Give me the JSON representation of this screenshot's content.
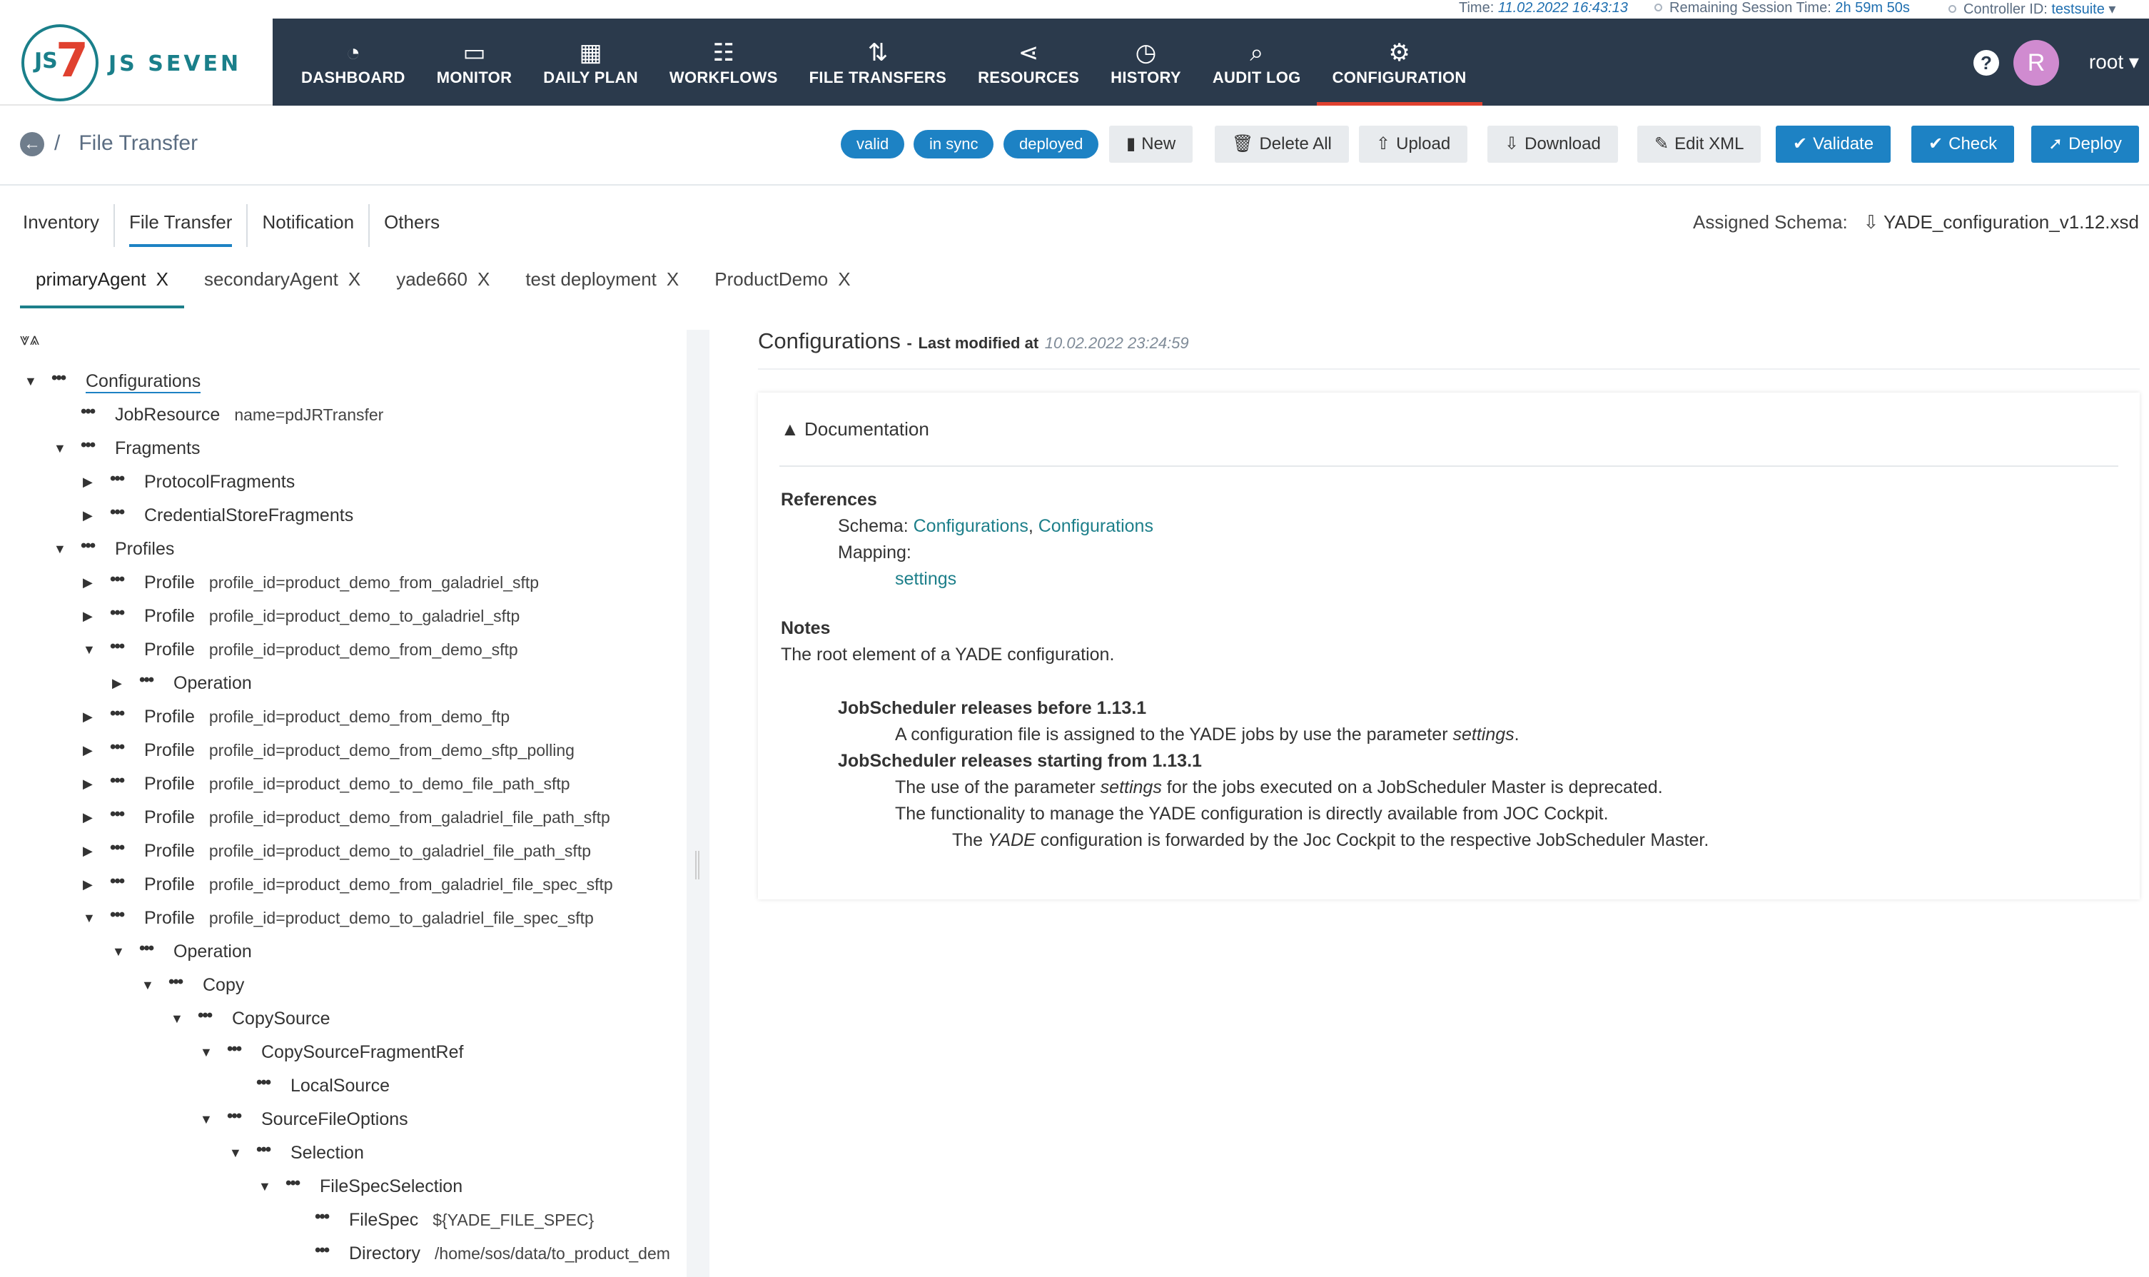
{
  "status": {
    "time_label": "Time:",
    "time_value": "11.02.2022 16:43:13",
    "session_label": "Remaining Session Time:",
    "session_value": "2h 59m 50s",
    "controller_label": "Controller ID:",
    "controller_value": "testsuite"
  },
  "brand": {
    "js": "JS",
    "seven": "7",
    "name": "JS SEVEN"
  },
  "nav": [
    {
      "label": "DASHBOARD",
      "icon": "dashboard-icon",
      "glyph": "◔"
    },
    {
      "label": "MONITOR",
      "icon": "monitor-icon",
      "glyph": "▭"
    },
    {
      "label": "DAILY PLAN",
      "icon": "calendar-icon",
      "glyph": "▦"
    },
    {
      "label": "WORKFLOWS",
      "icon": "workflow-icon",
      "glyph": "☷"
    },
    {
      "label": "FILE TRANSFERS",
      "icon": "transfer-icon",
      "glyph": "⇅"
    },
    {
      "label": "RESOURCES",
      "icon": "share-icon",
      "glyph": "⋖"
    },
    {
      "label": "HISTORY",
      "icon": "history-icon",
      "glyph": "◷"
    },
    {
      "label": "AUDIT LOG",
      "icon": "audit-icon",
      "glyph": "⌕"
    },
    {
      "label": "CONFIGURATION",
      "icon": "gear-icon",
      "glyph": "⚙"
    }
  ],
  "user": {
    "initial": "R",
    "name": "root ▾",
    "help": "?"
  },
  "breadcrumb": {
    "sep": "/",
    "title": "File Transfer"
  },
  "badges": [
    "valid",
    "in sync",
    "deployed"
  ],
  "buttons": {
    "new": "New",
    "delete_all": "Delete All",
    "upload": "Upload",
    "download": "Download",
    "edit_xml": "Edit XML",
    "validate": "Validate",
    "check": "Check",
    "deploy": "Deploy"
  },
  "subtabs": [
    "Inventory",
    "File Transfer",
    "Notification",
    "Others"
  ],
  "schema": {
    "label": "Assigned Schema:",
    "file": "YADE_configuration_v1.12.xsd"
  },
  "objtabs": [
    "primaryAgent",
    "secondaryAgent",
    "yade660",
    "test deployment",
    "ProductDemo"
  ],
  "tree": [
    {
      "d": 0,
      "c": "open",
      "n": "Configurations",
      "a": ""
    },
    {
      "d": 1,
      "c": "none",
      "n": "JobResource",
      "a": "name=pdJRTransfer"
    },
    {
      "d": 1,
      "c": "open",
      "n": "Fragments",
      "a": ""
    },
    {
      "d": 2,
      "c": "closed",
      "n": "ProtocolFragments",
      "a": ""
    },
    {
      "d": 2,
      "c": "closed",
      "n": "CredentialStoreFragments",
      "a": ""
    },
    {
      "d": 1,
      "c": "open",
      "n": "Profiles",
      "a": ""
    },
    {
      "d": 2,
      "c": "closed",
      "n": "Profile",
      "a": "profile_id=product_demo_from_galadriel_sftp"
    },
    {
      "d": 2,
      "c": "closed",
      "n": "Profile",
      "a": "profile_id=product_demo_to_galadriel_sftp"
    },
    {
      "d": 2,
      "c": "open",
      "n": "Profile",
      "a": "profile_id=product_demo_from_demo_sftp"
    },
    {
      "d": 3,
      "c": "closed",
      "n": "Operation",
      "a": ""
    },
    {
      "d": 2,
      "c": "closed",
      "n": "Profile",
      "a": "profile_id=product_demo_from_demo_ftp"
    },
    {
      "d": 2,
      "c": "closed",
      "n": "Profile",
      "a": "profile_id=product_demo_from_demo_sftp_polling"
    },
    {
      "d": 2,
      "c": "closed",
      "n": "Profile",
      "a": "profile_id=product_demo_to_demo_file_path_sftp"
    },
    {
      "d": 2,
      "c": "closed",
      "n": "Profile",
      "a": "profile_id=product_demo_from_galadriel_file_path_sftp"
    },
    {
      "d": 2,
      "c": "closed",
      "n": "Profile",
      "a": "profile_id=product_demo_to_galadriel_file_path_sftp"
    },
    {
      "d": 2,
      "c": "closed",
      "n": "Profile",
      "a": "profile_id=product_demo_from_galadriel_file_spec_sftp"
    },
    {
      "d": 2,
      "c": "open",
      "n": "Profile",
      "a": "profile_id=product_demo_to_galadriel_file_spec_sftp"
    },
    {
      "d": 3,
      "c": "open",
      "n": "Operation",
      "a": ""
    },
    {
      "d": 4,
      "c": "open",
      "n": "Copy",
      "a": ""
    },
    {
      "d": 5,
      "c": "open",
      "n": "CopySource",
      "a": ""
    },
    {
      "d": 6,
      "c": "open",
      "n": "CopySourceFragmentRef",
      "a": ""
    },
    {
      "d": 7,
      "c": "none",
      "n": "LocalSource",
      "a": ""
    },
    {
      "d": 6,
      "c": "open",
      "n": "SourceFileOptions",
      "a": ""
    },
    {
      "d": 7,
      "c": "open",
      "n": "Selection",
      "a": ""
    },
    {
      "d": 8,
      "c": "open",
      "n": "FileSpecSelection",
      "a": ""
    },
    {
      "d": 9,
      "c": "none",
      "n": "FileSpec",
      "a": "${YADE_FILE_SPEC}"
    },
    {
      "d": 9,
      "c": "none",
      "n": "Directory",
      "a": "/home/sos/data/to_product_dem"
    }
  ],
  "details": {
    "title": "Configurations",
    "dash": "-",
    "last_modified_label": "Last modified at",
    "last_modified_value": "10.02.2022 23:24:59",
    "doc_header": "Documentation",
    "references": "References",
    "schema_label": "Schema:",
    "schema_link1": "Configurations",
    "schema_comma": ",",
    "schema_link2": "Configurations",
    "mapping_label": "Mapping:",
    "mapping_link": "settings",
    "notes": "Notes",
    "notes_text": "The root element of a YADE configuration.",
    "release1": "JobScheduler releases before 1.13.1",
    "release1_text_a": "A configuration file is assigned to the YADE jobs by use the parameter",
    "release1_text_em": "settings",
    "release1_text_b": ".",
    "release2": "JobScheduler releases starting from 1.13.1",
    "release2_text1_a": "The use of the parameter",
    "release2_text1_em": "settings",
    "release2_text1_b": "for the jobs executed on a JobScheduler Master is deprecated.",
    "release2_text2": "The functionality to manage the YADE configuration is directly available from JOC Cockpit.",
    "release2_text3_a": "The",
    "release2_text3_em": "YADE",
    "release2_text3_b": "configuration is forwarded by the Joc Cockpit to the respective JobScheduler Master."
  }
}
